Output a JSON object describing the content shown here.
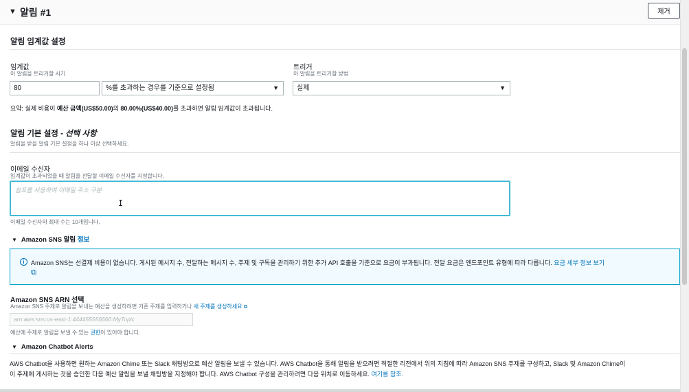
{
  "header": {
    "title": "알림 #1",
    "remove_label": "제거"
  },
  "threshold_section": {
    "title": "알림 임계값 설정",
    "threshold": {
      "label": "임계값",
      "desc": "이 알림을 트리거할 시기",
      "value": "80",
      "condition": "%를 초과하는 경우를 기준으로 설정됨"
    },
    "trigger": {
      "label": "트리거",
      "desc": "이 알림을 트리거할 방법",
      "value": "실제"
    },
    "summary_prefix": "요약: 실제 비용이 ",
    "summary_bold1": "예산 금액(US$50.00)",
    "summary_mid": "의 ",
    "summary_bold2": "80.00%(US$40.00)",
    "summary_suffix": "를 초과하면 알림 임계값이 초과됩니다."
  },
  "preferences": {
    "title_main": "알림 기본 설정 - ",
    "title_optional": "선택 사항",
    "desc": "알림을 받을 알림 기본 설정을 하나 이상 선택하세요."
  },
  "email": {
    "label": "이메일 수신자",
    "desc": "임계값이 초과되었을 때 알림을 전달할 이메일 수신자를 지정합니다.",
    "placeholder": "쉼표를 사용하여 이메일 주소 구분",
    "constraint": "이메일 수신자의 최대 수는 10개입니다."
  },
  "sns": {
    "heading": "Amazon SNS 알림",
    "info_link": "정보",
    "info_text": "Amazon SNS는 선결제 비용이 없습니다. 게시된 메시지 수, 전달하는 메시지 수, 주제 및 구독을 관리하기 위한 추가 API 호출을 기준으로 요금이 부과됩니다. 전달 요금은 엔드포인트 유형에 따라 다릅니다.",
    "pricing_link": "요금 세부 정보 보기",
    "arn_label": "Amazon SNS ARN 선택",
    "arn_desc": "Amazon SNS 주제로 알림을 보내는 예산을 생성하려면 기존 주제를 입력하거나 ",
    "arn_desc_link": "새 주제를 생성하세요",
    "arn_placeholder": "arn:aws:sns:us-east-1:444455556666:MyTopic",
    "permission_prefix": "예산에 주제로 알림을 보낼 수 있는 ",
    "permission_link": "권한",
    "permission_suffix": "이 있어야 합니다."
  },
  "chatbot": {
    "heading": "Amazon Chatbot Alerts",
    "line1": "AWS Chatbot을 사용하면 원하는 Amazon Chime 또는 Slack 채팅방으로 예산 알림을 보낼 수 있습니다. AWS Chatbot을 통해 알림을 받으려면 적절한 리전에서 위의 지침에 따라 Amazon SNS 주제를 구성하고, Slack 및 Amazon Chime이",
    "line2": "이 주제에 게시하는 것을 승인한 다음 예산 알림을 보낼 채팅방을 지정해야 합니다. AWS Chatbot 구성을 관리하려면 다음 위치로 이동하세요. ",
    "line2_link": "여기를 참조."
  }
}
